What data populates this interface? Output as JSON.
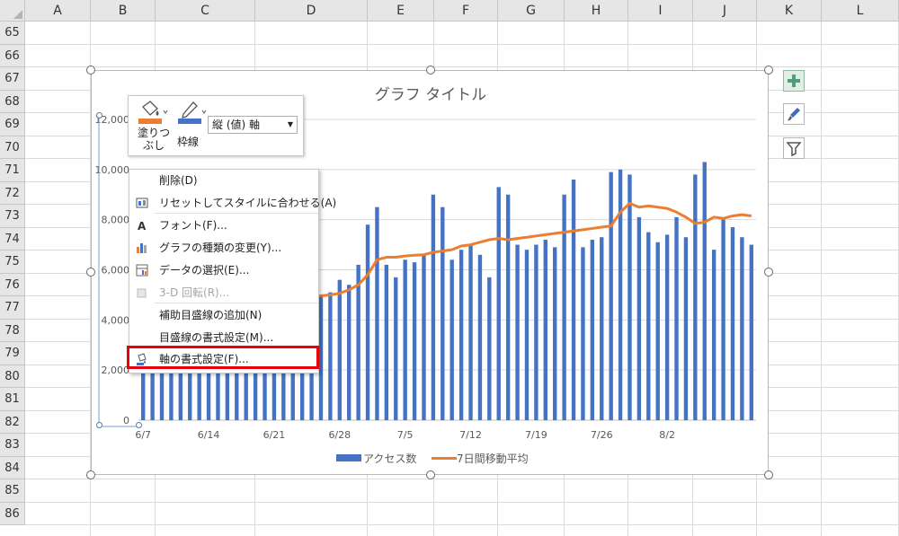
{
  "columns": [
    "A",
    "B",
    "C",
    "D",
    "E",
    "F",
    "G",
    "H",
    "I",
    "J",
    "K",
    "L"
  ],
  "rows": [
    "65",
    "66",
    "67",
    "68",
    "69",
    "70",
    "71",
    "72",
    "73",
    "74",
    "75",
    "76",
    "77",
    "78",
    "79",
    "80",
    "81",
    "82",
    "83",
    "84",
    "85",
    "86"
  ],
  "chart": {
    "title": "グラフ タイトル",
    "legend": {
      "bar_label": "アクセス数",
      "line_label": "7日間移動平均"
    }
  },
  "chart_data": {
    "type": "bar",
    "title": "グラフ タイトル",
    "ylim": [
      0,
      12000
    ],
    "yticks": [
      "0",
      "2,000",
      "4,000",
      "6,000",
      "8,000",
      "10,000",
      "12,000"
    ],
    "xticks": [
      "6/7",
      "6/14",
      "6/21",
      "6/28",
      "7/5",
      "7/12",
      "7/19",
      "7/26",
      "8/2"
    ],
    "grid": true,
    "legend_position": "bottom",
    "series": [
      {
        "name": "アクセス数",
        "kind": "bar",
        "color": "#4472c4",
        "values": [
          4600,
          4700,
          4800,
          4500,
          4400,
          4700,
          4800,
          4600,
          4900,
          5000,
          4800,
          4700,
          4900,
          5000,
          4800,
          4900,
          5000,
          5100,
          5200,
          5000,
          5100,
          5600,
          5400,
          6200,
          7800,
          8500,
          6200,
          5700,
          6400,
          6300,
          6600,
          9000,
          8500,
          6400,
          6800,
          7000,
          6600,
          5700,
          9300,
          9000,
          7000,
          6800,
          7000,
          7200,
          6900,
          9000,
          9600,
          6900,
          7200,
          7300,
          9900,
          10000,
          9800,
          8100,
          7500,
          7100,
          7400,
          8100,
          7300,
          9800,
          10300,
          6800,
          8000,
          7700,
          7300,
          7000
        ]
      },
      {
        "name": "7日間移動平均",
        "kind": "line",
        "color": "#ed7d31",
        "values": [
          null,
          null,
          null,
          null,
          null,
          null,
          4700,
          4720,
          4750,
          4760,
          4780,
          4800,
          4810,
          4820,
          4840,
          4860,
          4880,
          4900,
          4930,
          4960,
          5000,
          5060,
          5200,
          5400,
          5800,
          6400,
          6500,
          6500,
          6550,
          6580,
          6600,
          6700,
          6750,
          6800,
          6950,
          7000,
          7100,
          7200,
          7250,
          7200,
          7250,
          7300,
          7350,
          7400,
          7450,
          7500,
          7550,
          7600,
          7650,
          7700,
          7750,
          8300,
          8650,
          8500,
          8550,
          8500,
          8450,
          8300,
          8100,
          7850,
          7900,
          8100,
          8050,
          8150,
          8200,
          8150
        ]
      }
    ]
  },
  "mini_toolbar": {
    "fill_label": "塗りつ\nぶし",
    "outline_label": "枠線",
    "axis_select_value": "縦 (値) 軸"
  },
  "context_menu": [
    {
      "label": "削除(D)",
      "icon": "none",
      "disabled": false
    },
    {
      "label": "リセットしてスタイルに合わせる(A)",
      "icon": "reset-style-icon",
      "disabled": false
    },
    {
      "label": "フォント(F)...",
      "icon": "font-icon",
      "disabled": false
    },
    {
      "label": "グラフの種類の変更(Y)...",
      "icon": "chart-type-icon",
      "disabled": false
    },
    {
      "label": "データの選択(E)...",
      "icon": "select-data-icon",
      "disabled": false
    },
    {
      "label": "3-D 回転(R)...",
      "icon": "rotate-3d-icon",
      "disabled": true
    },
    {
      "label": "補助目盛線の追加(N)",
      "icon": "none",
      "disabled": false
    },
    {
      "label": "目盛線の書式設定(M)...",
      "icon": "none",
      "disabled": false
    },
    {
      "label": "軸の書式設定(F)...",
      "icon": "format-axis-icon",
      "disabled": false
    }
  ],
  "colors": {
    "highlight": "#e8000b",
    "plus_button": "#4e9f74"
  }
}
